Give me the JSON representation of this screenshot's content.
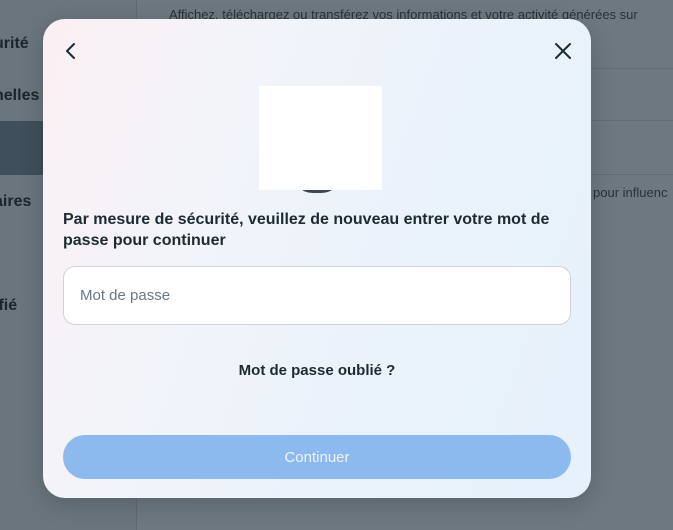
{
  "background": {
    "sidebar_items": [
      {
        "label": "urité"
      },
      {
        "label": "nelles"
      },
      {
        "label": ""
      },
      {
        "label": "aires"
      },
      {
        "label": "ifié"
      }
    ],
    "main_texts": [
      "Affichez, téléchargez ou transférez vos informations et votre activité générées sur",
      "pour influenc"
    ]
  },
  "modal": {
    "back_icon": "chevron-left-icon",
    "close_icon": "close-icon",
    "heading": "Par mesure de sécurité, veuillez de nouveau entrer votre mot de passe pour continuer",
    "password": {
      "placeholder": "Mot de passe",
      "value": ""
    },
    "forgot_password_label": "Mot de passe oublié ?",
    "continue_label": "Continuer",
    "colors": {
      "continue_button_disabled": "#8cbaee",
      "text_primary": "#1c2b33"
    }
  }
}
